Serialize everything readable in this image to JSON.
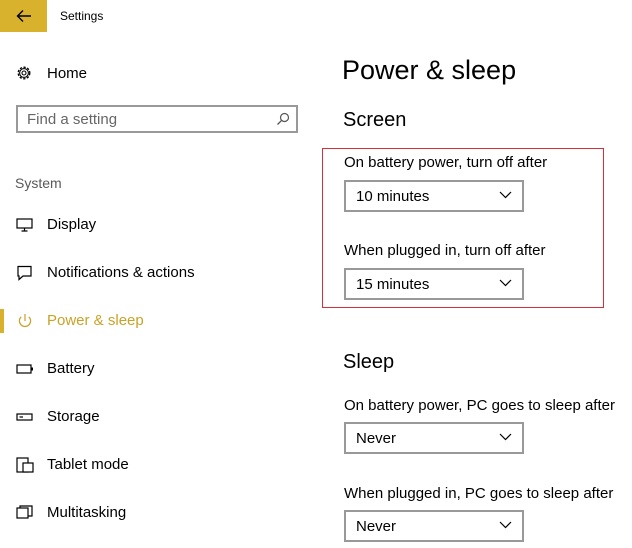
{
  "window": {
    "title": "Settings"
  },
  "sidebar": {
    "home_label": "Home",
    "search": {
      "placeholder": "Find a setting"
    },
    "section_label": "System",
    "items": [
      {
        "label": "Display",
        "icon": "display-icon"
      },
      {
        "label": "Notifications & actions",
        "icon": "notifications-icon"
      },
      {
        "label": "Power & sleep",
        "icon": "power-icon",
        "active": true
      },
      {
        "label": "Battery",
        "icon": "battery-icon"
      },
      {
        "label": "Storage",
        "icon": "storage-icon"
      },
      {
        "label": "Tablet mode",
        "icon": "tablet-mode-icon"
      },
      {
        "label": "Multitasking",
        "icon": "multitasking-icon"
      }
    ]
  },
  "main": {
    "title": "Power & sleep",
    "screen": {
      "heading": "Screen",
      "battery_label": "On battery power, turn off after",
      "battery_value": "10 minutes",
      "plugged_label": "When plugged in, turn off after",
      "plugged_value": "15 minutes"
    },
    "sleep": {
      "heading": "Sleep",
      "battery_label": "On battery power, PC goes to sleep after",
      "battery_value": "Never",
      "plugged_label": "When plugged in, PC goes to sleep after",
      "plugged_value": "Never"
    }
  },
  "colors": {
    "accent": "#d8b22d",
    "active_text": "#c9a227",
    "highlight_border": "#d0313b",
    "control_border": "#999999"
  }
}
